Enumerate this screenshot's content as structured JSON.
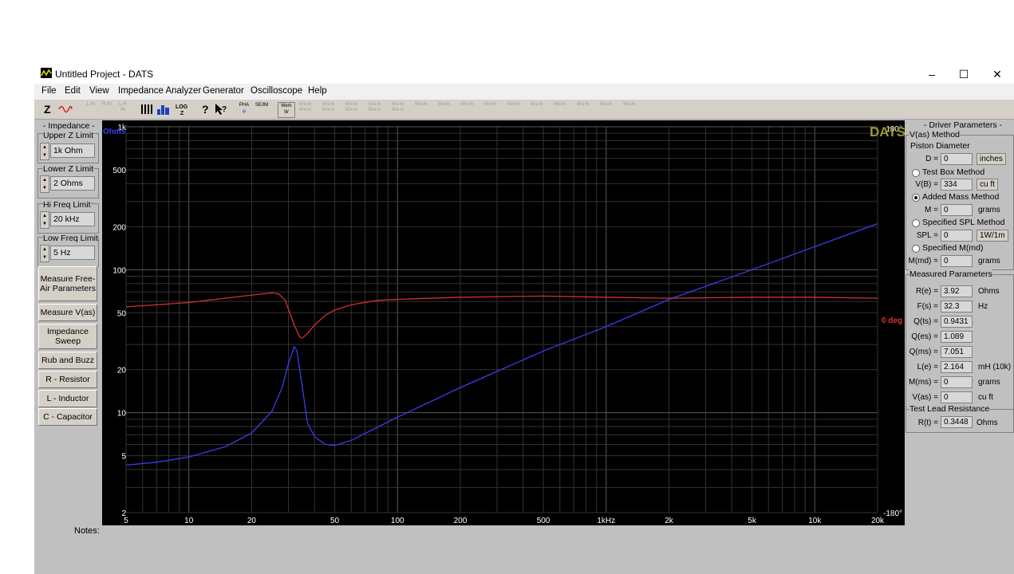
{
  "window": {
    "title": "Untitled Project - DATS",
    "controls": [
      "–",
      "☐",
      "✕"
    ]
  },
  "menu": [
    "File",
    "Edit",
    "View",
    "Impedance Analyzer",
    "Generator",
    "Oscilloscope",
    "Help"
  ],
  "toolbar": {
    "z": "Z",
    "phase": "PHA",
    "se_im": "SE/IM",
    "mem_w": "Mem W",
    "dim": [
      "L IN",
      "R IN",
      "L-R IN"
    ],
    "mem_slots": "Mem"
  },
  "left_panel": {
    "header": "- Impedance -",
    "upper_z": {
      "label": "Upper Z Limit",
      "value": "1k Ohm"
    },
    "lower_z": {
      "label": "Lower Z Limit",
      "value": "2 Ohms"
    },
    "hi_freq": {
      "label": "Hi Freq Limit",
      "value": "20 kHz"
    },
    "low_freq": {
      "label": "Low Freq Limit",
      "value": "5 Hz"
    },
    "buttons": {
      "measure_free_air": "Measure Free-Air Parameters",
      "measure_vas": "Measure V(as)",
      "impedance_sweep": "Impedance Sweep",
      "rub_buzz": "Rub and Buzz",
      "resistor": "R - Resistor",
      "inductor": "L - Inductor",
      "capacitor": "C - Capacitor"
    }
  },
  "notes_label": "Notes:",
  "chart_data": {
    "type": "line",
    "watermark": "DATS",
    "y_unit": "Ohms",
    "y_scale": "log",
    "x_scale": "log",
    "xlim": [
      5,
      20000
    ],
    "ylim": [
      2,
      1000
    ],
    "y_ticks": [
      "1k",
      "500",
      "200",
      "100",
      "50",
      "20",
      "10",
      "5",
      "2"
    ],
    "y_tick_values": [
      1000,
      500,
      200,
      100,
      50,
      20,
      10,
      5,
      2
    ],
    "x_ticks": [
      "5",
      "10",
      "20",
      "50",
      "100",
      "200",
      "500",
      "1kHz",
      "2k",
      "5k",
      "10k",
      "20k"
    ],
    "x_tick_values": [
      5,
      10,
      20,
      50,
      100,
      200,
      500,
      1000,
      2000,
      5000,
      10000,
      20000
    ],
    "phase_ticks": [
      "180°",
      "0 deg",
      "-180°"
    ],
    "phase_tick_values": [
      180,
      0,
      -180
    ],
    "phase_range": [
      -180,
      180
    ],
    "colors": {
      "impedance": "#3c3cf0",
      "phase": "#d03030",
      "unit_label": "#3c3cf0",
      "phase_label": "#e03030",
      "watermark": "#9a9a30"
    },
    "series": [
      {
        "name": "Ohms",
        "axis": "impedance",
        "x": [
          5,
          7,
          10,
          15,
          20,
          25,
          28,
          30,
          32,
          33,
          35,
          37,
          40,
          45,
          50,
          60,
          80,
          100,
          200,
          500,
          1000,
          2000,
          5000,
          10000,
          20000
        ],
        "y": [
          4.3,
          4.5,
          4.9,
          5.8,
          7.2,
          10.2,
          15,
          22,
          29,
          27,
          15,
          8.5,
          6.8,
          6.0,
          5.9,
          6.4,
          7.9,
          9.3,
          15,
          27,
          40,
          62,
          100,
          145,
          210
        ]
      },
      {
        "name": "Phase",
        "axis": "phase",
        "x": [
          5,
          10,
          20,
          25,
          27,
          29,
          30,
          32,
          34,
          35,
          37,
          40,
          45,
          50,
          60,
          80,
          100,
          200,
          500,
          1000,
          2000,
          5000,
          10000,
          20000
        ],
        "y": [
          12,
          16,
          23,
          25,
          24,
          18,
          10,
          -5,
          -16,
          -17,
          -13,
          -5,
          4,
          9,
          14,
          18,
          19,
          21,
          22,
          21,
          20,
          21,
          21,
          20
        ]
      }
    ]
  },
  "right_panel": {
    "header": "- Driver Parameters -",
    "vas_method": "V(as) Method",
    "piston_diameter": "Piston Diameter",
    "d": {
      "label": "D =",
      "value": "0",
      "unit": "inches"
    },
    "test_box": "Test Box Method",
    "vb": {
      "label": "V(B) =",
      "value": "334",
      "unit": "cu ft"
    },
    "added_mass": "Added Mass Method",
    "m": {
      "label": "M =",
      "value": "0",
      "unit": "grams"
    },
    "spl_method": "Specified SPL Method",
    "spl": {
      "label": "SPL =",
      "value": "0",
      "unit": "1W/1m"
    },
    "mmd_method": "Specified M(md)",
    "mmd": {
      "label": "M(md) =",
      "value": "0",
      "unit": "grams"
    },
    "measured_header": "Measured Parameters",
    "measured": [
      {
        "label": "R(e) =",
        "value": "3.92",
        "unit": "Ohms"
      },
      {
        "label": "F(s) =",
        "value": "32.3",
        "unit": "Hz"
      },
      {
        "label": "Q(ts) =",
        "value": "0.9431",
        "unit": ""
      },
      {
        "label": "Q(es) =",
        "value": "1.089",
        "unit": ""
      },
      {
        "label": "Q(ms) =",
        "value": "7.051",
        "unit": ""
      },
      {
        "label": "L(e) =",
        "value": "2.164",
        "unit": "mH (10k)"
      },
      {
        "label": "M(ms) =",
        "value": "0",
        "unit": "grams"
      },
      {
        "label": "V(as) =",
        "value": "0",
        "unit": "cu ft"
      }
    ],
    "lead_header": "Test Lead Resistance",
    "rt": {
      "label": "R(t) =",
      "value": "0.3448",
      "unit": "Ohms"
    }
  }
}
